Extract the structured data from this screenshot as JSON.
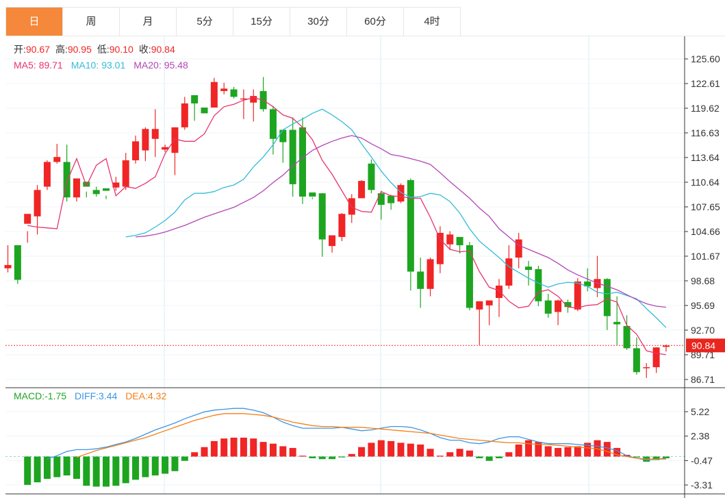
{
  "tabs": [
    {
      "label": "日",
      "active": true
    },
    {
      "label": "周",
      "active": false
    },
    {
      "label": "月",
      "active": false
    },
    {
      "label": "5分",
      "active": false
    },
    {
      "label": "15分",
      "active": false
    },
    {
      "label": "30分",
      "active": false
    },
    {
      "label": "60分",
      "active": false
    },
    {
      "label": "4时",
      "active": false
    }
  ],
  "ohlc_info": {
    "open_label": "开:",
    "open": "90.67",
    "high_label": "高:",
    "high": "90.95",
    "low_label": "低:",
    "low": "90.10",
    "close_label": "收:",
    "close": "90.84"
  },
  "ma_info": {
    "ma5_label": "MA5:",
    "ma5": "89.71",
    "ma10_label": "MA10:",
    "ma10": "93.01",
    "ma20_label": "MA20:",
    "ma20": "95.48"
  },
  "macd_info": {
    "macd_label": "MACD:",
    "macd": "-1.75",
    "diff_label": "DIFF:",
    "diff": "3.44",
    "dea_label": "DEA:",
    "dea": "4.32"
  },
  "colors": {
    "up": "#f02525",
    "down": "#1da520",
    "ma5": "#e8336e",
    "ma10": "#33bbd8",
    "ma20": "#b245b7",
    "diff": "#3c95e6",
    "dea": "#f57f17",
    "text_label": "#333333"
  },
  "chart_data": {
    "type": "candlestick",
    "price_axis": {
      "ticks": [
        125.6,
        122.61,
        119.62,
        116.63,
        113.64,
        110.64,
        107.65,
        104.66,
        101.67,
        98.68,
        95.69,
        92.7,
        89.71,
        86.71
      ],
      "last_price": 90.84
    },
    "macd_axis": {
      "ticks": [
        5.22,
        2.38,
        -0.47,
        -3.31
      ]
    },
    "candles": [
      [
        100.2,
        100.6,
        103.7,
        103.0,
        99.7
      ],
      [
        103.0,
        98.8,
        106.0,
        102.3,
        98.3
      ],
      [
        105.6,
        106.8,
        105.6,
        104.7,
        103.3
      ],
      [
        106.5,
        109.7,
        106.5,
        110.3,
        104.3
      ],
      [
        110.1,
        113.1,
        110.1,
        113.3,
        109.7
      ],
      [
        113.1,
        113.7,
        113.1,
        115.3,
        112.9
      ],
      [
        113.1,
        108.8,
        113.1,
        115.2,
        108.3
      ],
      [
        108.8,
        111.1,
        111.4,
        108.3,
        108.8
      ],
      [
        110.7,
        110.1,
        111.7,
        109.5,
        108.8
      ],
      [
        109.7,
        109.2,
        109.7,
        110.1,
        108.9
      ],
      [
        109.9,
        109.6,
        110.7,
        109.0,
        108.6
      ],
      [
        110.0,
        110.6,
        110.3,
        111.3,
        109.6
      ],
      [
        110.1,
        113.3,
        111.5,
        114.2,
        109.7
      ],
      [
        113.3,
        115.6,
        114.2,
        116.3,
        112.9
      ],
      [
        114.5,
        117.1,
        115.7,
        117.3,
        113.2
      ],
      [
        115.9,
        117.1,
        115.9,
        119.5,
        113.7
      ],
      [
        114.6,
        114.9,
        114.7,
        115.2,
        114.3
      ],
      [
        114.2,
        117.3,
        114.2,
        117.3,
        111.5
      ],
      [
        117.3,
        120.2,
        119.0,
        121.0,
        117.0
      ],
      [
        121.2,
        120.2,
        121.3,
        120.2,
        118.1
      ],
      [
        119.7,
        119.0,
        119.4,
        119.5,
        119.6
      ],
      [
        119.7,
        122.8,
        121.6,
        123.3,
        119.7
      ],
      [
        121.7,
        122.0,
        122.1,
        122.7,
        121.3
      ],
      [
        121.9,
        121.0,
        121.0,
        122.2,
        120.8
      ],
      [
        120.8,
        120.8,
        121.7,
        121.9,
        118.3
      ],
      [
        120.3,
        121.1,
        121.7,
        121.9,
        118.0
      ],
      [
        121.7,
        119.5,
        121.4,
        123.4,
        119.2
      ],
      [
        119.5,
        115.9,
        119.0,
        119.9,
        114.0
      ],
      [
        117.0,
        115.5,
        117.3,
        117.0,
        113.0
      ],
      [
        117.0,
        110.4,
        117.0,
        118.5,
        108.9
      ],
      [
        117.3,
        108.9,
        117.3,
        118.5,
        108.0
      ],
      [
        109.4,
        108.9,
        110.6,
        108.8,
        108.6
      ],
      [
        109.3,
        103.7,
        109.3,
        109.3,
        101.6
      ],
      [
        102.9,
        104.2,
        103.9,
        104.2,
        102.1
      ],
      [
        104.0,
        106.8,
        104.3,
        106.9,
        103.5
      ],
      [
        106.7,
        108.7,
        108.8,
        109.2,
        105.7
      ],
      [
        108.7,
        110.8,
        110.4,
        110.9,
        108.8
      ],
      [
        112.9,
        109.7,
        112.9,
        113.4,
        109.3
      ],
      [
        109.3,
        107.9,
        109.0,
        109.6,
        106.1
      ],
      [
        109.0,
        108.1,
        109.1,
        109.1,
        107.3
      ],
      [
        108.3,
        110.3,
        110.4,
        110.5,
        108.1
      ],
      [
        110.9,
        99.8,
        110.9,
        111.1,
        97.5
      ],
      [
        99.8,
        97.7,
        100.5,
        101.5,
        95.4
      ],
      [
        97.7,
        101.3,
        101.3,
        101.5,
        96.8
      ],
      [
        100.7,
        104.5,
        104.5,
        105.3,
        99.6
      ],
      [
        103.1,
        104.3,
        104.6,
        104.7,
        102.4
      ],
      [
        104.0,
        103.0,
        103.9,
        104.0,
        102.0
      ],
      [
        103.0,
        95.4,
        103.0,
        103.4,
        95.1
      ],
      [
        95.2,
        96.2,
        96.1,
        96.2,
        90.9
      ],
      [
        95.7,
        96.3,
        96.3,
        96.3,
        93.3
      ],
      [
        96.6,
        98.1,
        97.2,
        98.9,
        94.3
      ],
      [
        98.1,
        101.4,
        101.3,
        103.0,
        97.7
      ],
      [
        101.5,
        103.7,
        103.9,
        104.5,
        100.2
      ],
      [
        100.4,
        100.0,
        100.9,
        101.1,
        98.1
      ],
      [
        100.1,
        96.2,
        99.9,
        100.5,
        95.6
      ],
      [
        96.3,
        94.7,
        96.6,
        97.1,
        94.2
      ],
      [
        94.9,
        96.3,
        96.3,
        96.4,
        93.3
      ],
      [
        96.1,
        95.5,
        96.5,
        96.4,
        94.8
      ],
      [
        95.2,
        98.6,
        98.4,
        99.0,
        95.0
      ],
      [
        98.6,
        98.0,
        98.7,
        100.2,
        97.4
      ],
      [
        97.8,
        98.9,
        98.9,
        101.7,
        96.7
      ],
      [
        98.9,
        94.4,
        98.9,
        99.0,
        92.7
      ],
      [
        93.7,
        93.4,
        94.2,
        96.8,
        90.9
      ],
      [
        93.2,
        90.5,
        93.7,
        94.5,
        90.3
      ],
      [
        90.5,
        87.6,
        90.5,
        91.8,
        87.3
      ],
      [
        88.1,
        88.2,
        88.3,
        88.7,
        86.9
      ],
      [
        88.2,
        90.6,
        90.5,
        90.6,
        87.5
      ],
      [
        90.67,
        90.84,
        90.95,
        90.95,
        90.1
      ]
    ],
    "ma5": [
      105.4,
      105.2,
      105.1,
      105.0,
      110.7,
      113.5,
      110.2,
      112.7,
      113.5,
      109.0,
      110.1,
      109.9,
      110.5,
      111.3,
      114.1,
      115.9,
      115.6,
      115.6,
      116.5,
      118.7,
      119.8,
      120.1,
      120.6,
      120.9,
      120.6,
      119.8,
      118.8,
      118.4,
      117.3,
      115.8,
      113.3,
      111.6,
      109.6,
      107.6,
      107.1,
      107.0,
      109.5,
      109.0,
      108.9,
      108.7,
      108.7,
      106.4,
      103.7,
      102.5,
      102.2,
      102.3,
      99.8,
      97.9,
      97.5,
      96.2,
      95.4,
      95.6,
      97.3,
      97.6,
      96.8,
      95.5,
      95.4,
      95.7,
      95.8,
      96.5,
      96.1,
      93.3,
      92.2,
      90.2,
      89.9,
      89.71
    ],
    "ma10": [
      104.0,
      104.2,
      104.5,
      105.2,
      106.0,
      107.0,
      108.5,
      109.3,
      109.3,
      109.5,
      110.0,
      110.3,
      111.0,
      112.5,
      113.7,
      115.2,
      117.0,
      117.7,
      118.3,
      119.0,
      119.5,
      118.8,
      118.0,
      117.0,
      115.3,
      113.7,
      112.0,
      110.6,
      109.4,
      108.8,
      108.9,
      109.3,
      109.1,
      108.3,
      106.9,
      105.0,
      103.5,
      102.5,
      101.5,
      100.4,
      99.7,
      99.0,
      98.4,
      97.9,
      98.3,
      98.5,
      98.4,
      98.0,
      97.3,
      97.1,
      97.3,
      96.9,
      96.5,
      95.3,
      94.2,
      93.01
    ],
    "ma20": [
      104.0,
      104.1,
      104.3,
      104.6,
      105.0,
      105.4,
      105.9,
      106.4,
      106.8,
      107.2,
      107.6,
      108.2,
      108.8,
      109.6,
      110.6,
      111.5,
      112.6,
      113.6,
      114.5,
      115.1,
      115.6,
      116.0,
      116.3,
      116.0,
      115.3,
      114.7,
      114.0,
      113.8,
      113.5,
      113.2,
      112.8,
      111.8,
      110.7,
      109.7,
      108.7,
      107.5,
      106.5,
      105.0,
      104.0,
      103.0,
      102.5,
      102.0,
      101.5,
      100.8,
      100.0,
      99.4,
      98.9,
      98.4,
      98.0,
      97.6,
      97.0,
      96.4,
      95.9,
      95.6,
      95.48
    ],
    "macd_hist": [
      -3.3,
      -3.0,
      -2.6,
      -2.4,
      -2.2,
      -2.6,
      -3.4,
      -3.5,
      -3.5,
      -3.4,
      -3.1,
      -2.7,
      -2.4,
      -2.2,
      -2.0,
      -1.7,
      -0.5,
      0.5,
      1.1,
      1.8,
      2.1,
      2.2,
      2.2,
      2.1,
      1.7,
      1.5,
      1.2,
      1.0,
      0.1,
      -0.2,
      -0.3,
      -0.3,
      -0.1,
      0.3,
      1.1,
      1.6,
      1.9,
      1.8,
      1.6,
      1.5,
      1.4,
      0.9,
      0.1,
      0.5,
      0.9,
      0.7,
      -0.2,
      -0.5,
      -0.2,
      0.5,
      1.4,
      1.9,
      1.7,
      1.2,
      1.0,
      1.1,
      1.2,
      1.6,
      1.9,
      1.7,
      1.0,
      0.2,
      -0.1,
      -0.6,
      -0.4,
      -0.2
    ],
    "diff": [
      -0.3,
      0.1,
      0.6,
      0.8,
      0.8,
      0.9,
      1.1,
      1.4,
      1.7,
      2.1,
      2.6,
      3.1,
      3.5,
      3.9,
      4.4,
      4.8,
      5.2,
      5.4,
      5.5,
      5.6,
      5.6,
      5.4,
      5.1,
      4.6,
      4.0,
      3.6,
      3.3,
      3.3,
      3.3,
      3.3,
      3.4,
      3.2,
      3.0,
      3.1,
      3.3,
      3.5,
      3.5,
      3.4,
      3.1,
      2.7,
      2.2,
      1.9,
      1.9,
      1.6,
      1.5,
      1.7,
      2.1,
      2.3,
      2.3,
      2.0,
      1.7,
      1.5,
      1.5,
      1.5,
      1.4,
      1.3,
      1.2,
      1.0,
      0.7,
      0.1,
      -0.2,
      -0.4,
      -0.3,
      -0.2
    ],
    "dea": [
      -0.1,
      0.3,
      0.7,
      1.0,
      1.3,
      1.6,
      1.9,
      2.2,
      2.6,
      3.0,
      3.4,
      3.8,
      4.2,
      4.5,
      4.8,
      5.0,
      5.0,
      5.0,
      4.9,
      4.8,
      4.6,
      4.3,
      4.0,
      3.8,
      3.6,
      3.5,
      3.5,
      3.4,
      3.4,
      3.4,
      3.3,
      3.2,
      3.1,
      3.0,
      2.9,
      2.8,
      2.7,
      2.5,
      2.3,
      2.1,
      2.0,
      1.9,
      1.8,
      1.7,
      1.6,
      1.6,
      1.5,
      1.4,
      1.4,
      1.3,
      1.2,
      1.1,
      1.0,
      0.9,
      0.6,
      0.2,
      0.0,
      -0.2,
      -0.3,
      -0.3,
      -0.3
    ]
  }
}
